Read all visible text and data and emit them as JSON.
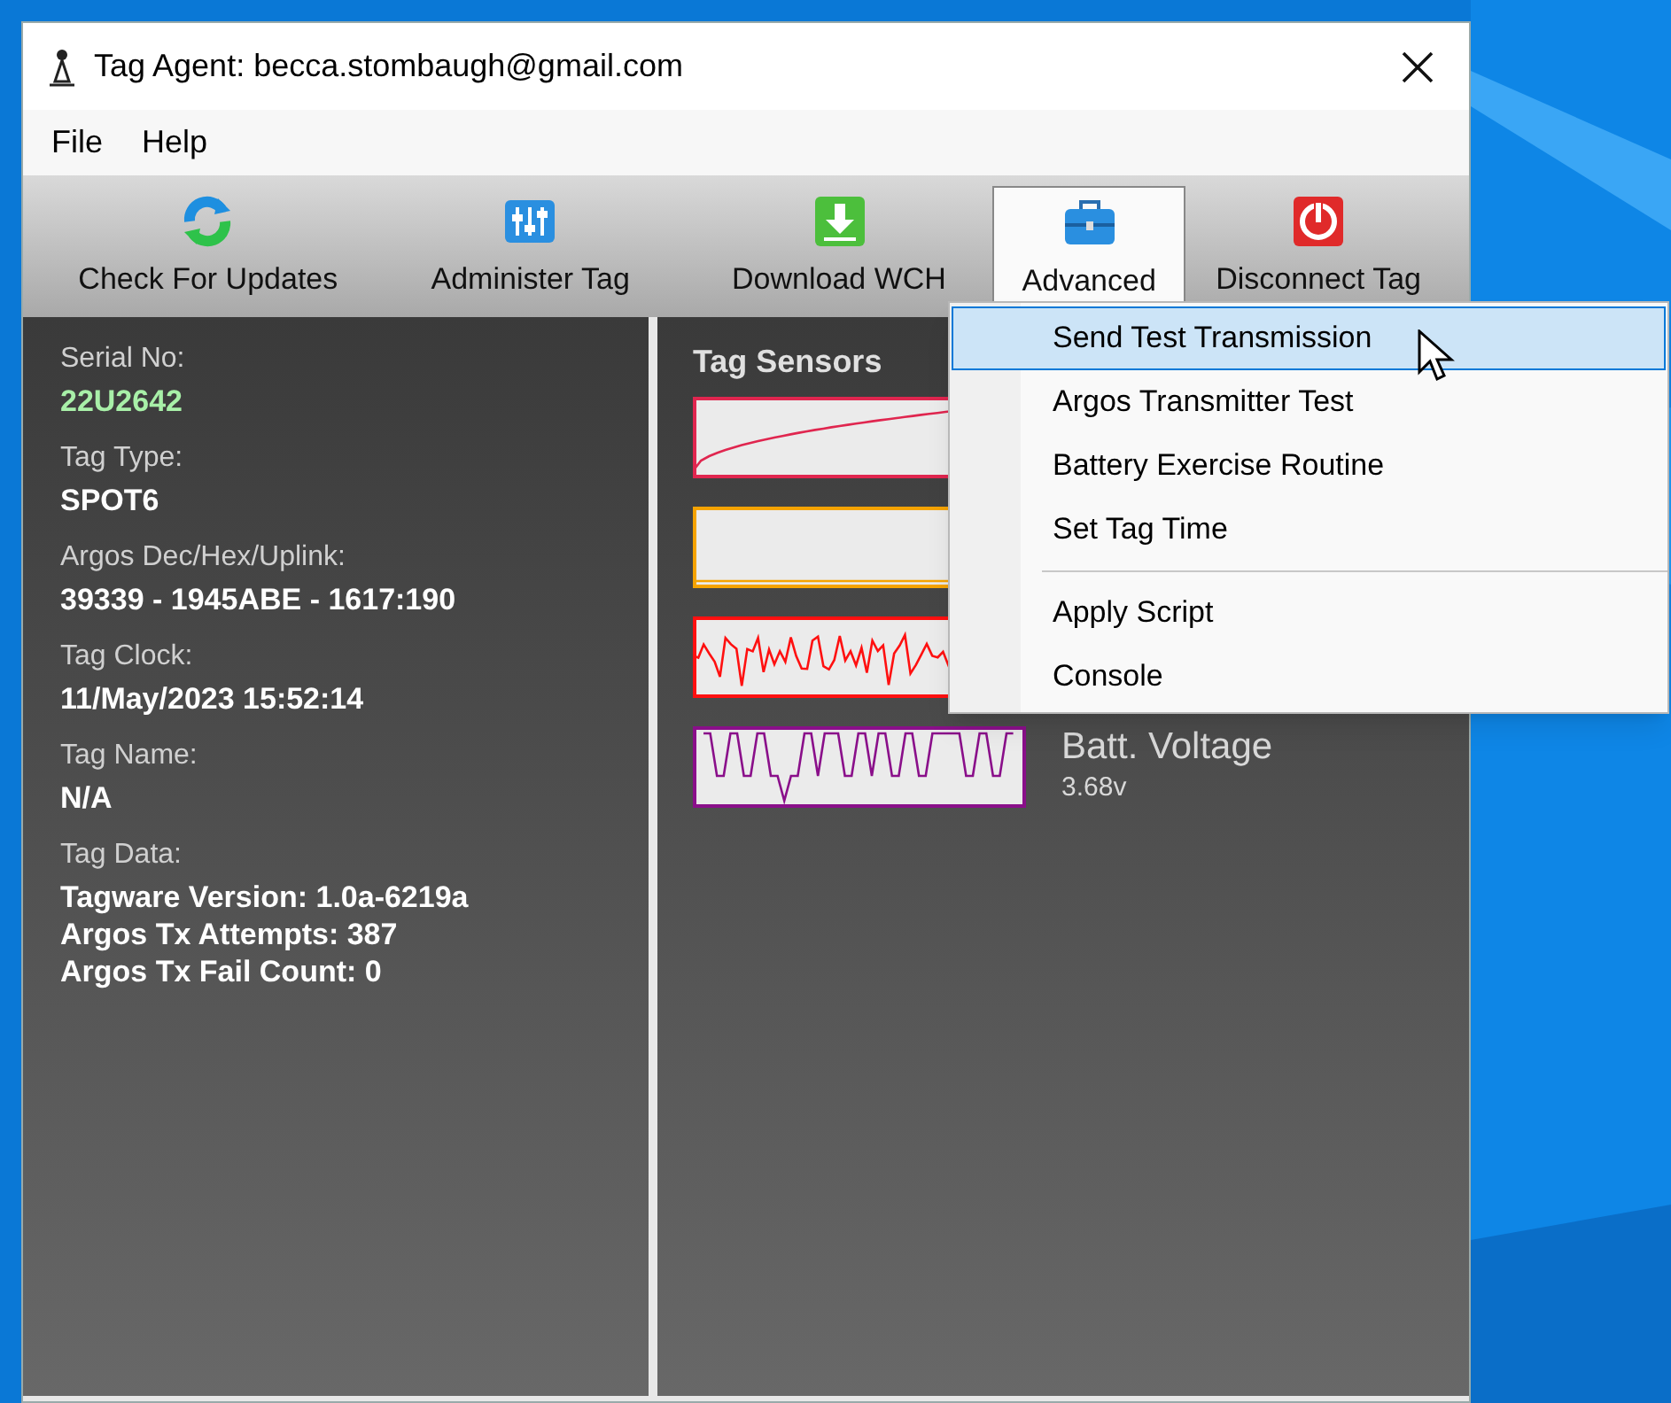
{
  "window": {
    "title": "Tag Agent: becca.stombaugh@gmail.com"
  },
  "menu_bar": [
    "File",
    "Help"
  ],
  "toolbar": [
    {
      "label": "Check For Updates",
      "kind": "refresh",
      "selected": false
    },
    {
      "label": "Administer Tag",
      "kind": "sliders",
      "selected": false
    },
    {
      "label": "Download WCH",
      "kind": "download",
      "selected": false
    },
    {
      "label": "Advanced",
      "kind": "toolbox",
      "selected": true
    },
    {
      "label": "Disconnect Tag",
      "kind": "power",
      "selected": false
    }
  ],
  "tag_info": [
    {
      "label": "Serial No:",
      "values": [
        "22U2642"
      ],
      "kind": "highlight"
    },
    {
      "label": "Tag Type:",
      "values": [
        "SPOT6"
      ],
      "kind": "plain"
    },
    {
      "label": "Argos Dec/Hex/Uplink:",
      "values": [
        "39339 - 1945ABE - 1617:190"
      ],
      "kind": "plain"
    },
    {
      "label": "Tag Clock:",
      "values": [
        "11/May/2023 15:52:14"
      ],
      "kind": "plain"
    },
    {
      "label": "Tag Name:",
      "values": [
        "N/A"
      ],
      "kind": "plain"
    },
    {
      "label": "Tag Data:",
      "values": [
        "Tagware Version: 1.0a-6219a",
        "Argos Tx Attempts: 387",
        "Argos Tx Fail Count: 0"
      ],
      "kind": "plain"
    }
  ],
  "sensors": {
    "title": "Tag Sensors",
    "items": [
      {
        "color": "#e0264f",
        "kind": "ramp"
      },
      {
        "color": "#f5a300",
        "kind": "flat"
      },
      {
        "color": "#ff1010",
        "kind": "noise"
      },
      {
        "color": "#8a0f8a",
        "kind": "square",
        "label": "Batt. Voltage",
        "reading": "3.68v"
      }
    ]
  },
  "dropdown": [
    {
      "kind": "item",
      "label": "Send Test Transmission",
      "selected": true
    },
    {
      "kind": "item",
      "label": "Argos Transmitter Test",
      "selected": false
    },
    {
      "kind": "item",
      "label": "Battery Exercise Routine",
      "selected": false
    },
    {
      "kind": "item",
      "label": "Set Tag Time",
      "selected": false
    },
    {
      "kind": "separator"
    },
    {
      "kind": "item",
      "label": "Apply Script",
      "selected": false
    },
    {
      "kind": "item",
      "label": "Console",
      "selected": false
    }
  ]
}
